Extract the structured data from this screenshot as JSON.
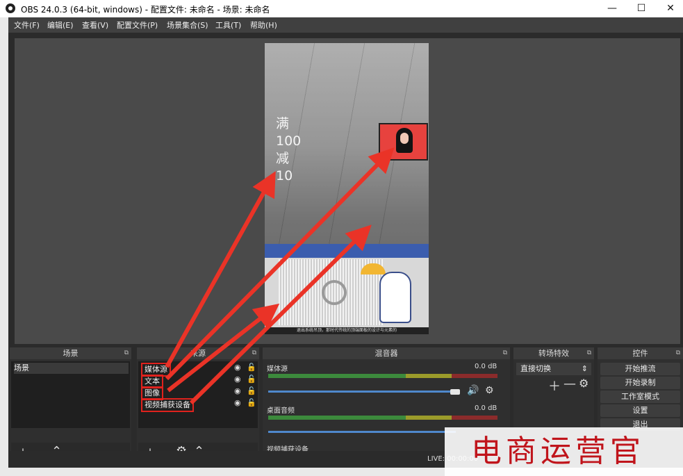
{
  "window": {
    "title": "OBS 24.0.3 (64-bit, windows) - 配置文件: 未命名 - 场景: 未命名",
    "minimize": "—",
    "maximize": "☐",
    "close": "✕"
  },
  "menu": [
    "文件(F)",
    "编辑(E)",
    "查看(V)",
    "配置文件(P)",
    "场景集合(S)",
    "工具(T)",
    "帮助(H)"
  ],
  "preview": {
    "promo_lines": [
      "满",
      "100",
      "减",
      "10"
    ],
    "caption": "退出系统吊顶，那时代传统的顶端面板的设计与元素的"
  },
  "docks": {
    "scenes_title": "场景",
    "sources_title": "来源",
    "mixer_title": "混音器",
    "transitions_title": "转场特效",
    "controls_title": "控件"
  },
  "scenes": [
    "场景"
  ],
  "sources": [
    "媒体源",
    "文本",
    "图像",
    "视频捕获设备"
  ],
  "mixer": {
    "tracks": [
      {
        "name": "媒体源",
        "db": "0.0 dB"
      },
      {
        "name": "桌面音频",
        "db": "0.0 dB"
      },
      {
        "name": "视频捕获设备",
        "db": ""
      }
    ],
    "scale": [
      "-60",
      "-55",
      "-50",
      "-45",
      "-40",
      "-35",
      "-30",
      "-25",
      "-20",
      "-15",
      "-10",
      "-5",
      "0"
    ]
  },
  "transitions": {
    "selected": "直接切换"
  },
  "controls": [
    "开始推流",
    "开始录制",
    "工作室模式",
    "设置",
    "退出"
  ],
  "status": {
    "live": "LIVE: 00:00:00"
  },
  "watermark": "电商运营官",
  "colors": {
    "accent_red": "#e0221d",
    "panel_bg": "#2b2b2b",
    "meter_green": "#3c8a3c"
  }
}
